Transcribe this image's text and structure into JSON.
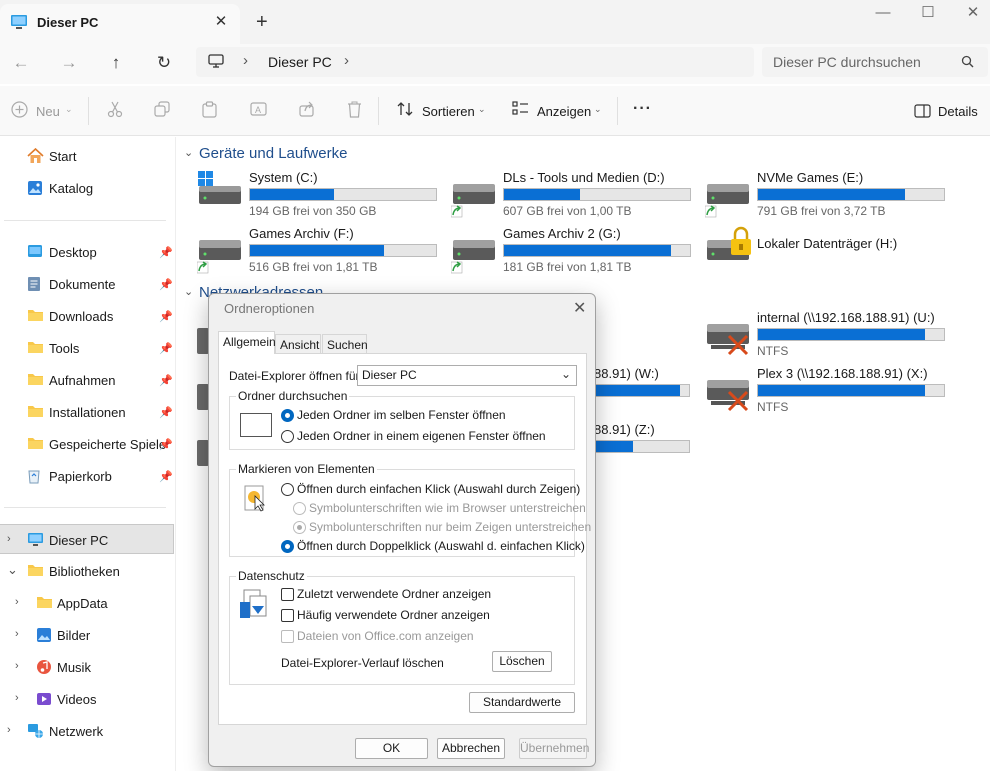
{
  "window": {
    "tab_title": "Dieser PC",
    "close_tab": "✕",
    "new_tab": "+",
    "minimize": "—",
    "maximize": "☐",
    "close": "✕"
  },
  "nav": {
    "location": "Dieser PC",
    "search_placeholder": "Dieser PC durchsuchen"
  },
  "toolbar": {
    "new_label": "Neu",
    "sort_label": "Sortieren",
    "view_label": "Anzeigen",
    "more_label": "···",
    "details_label": "Details"
  },
  "sidebar": {
    "top": [
      {
        "label": "Start",
        "icon": "home-icon"
      },
      {
        "label": "Katalog",
        "icon": "gallery-icon"
      }
    ],
    "quick": [
      {
        "label": "Desktop",
        "icon": "desktop-folder-icon"
      },
      {
        "label": "Dokumente",
        "icon": "documents-icon"
      },
      {
        "label": "Downloads",
        "icon": "folder-icon"
      },
      {
        "label": "Tools",
        "icon": "folder-icon"
      },
      {
        "label": "Aufnahmen",
        "icon": "folder-icon"
      },
      {
        "label": "Installationen",
        "icon": "folder-icon"
      },
      {
        "label": "Gespeicherte Spiele",
        "icon": "folder-icon"
      },
      {
        "label": "Papierkorb",
        "icon": "recycle-bin-icon"
      }
    ],
    "tree": [
      {
        "label": "Dieser PC",
        "icon": "computer-icon"
      },
      {
        "label": "Bibliotheken",
        "icon": "folder-icon"
      },
      {
        "label": "AppData",
        "icon": "folder-icon"
      },
      {
        "label": "Bilder",
        "icon": "pictures-icon"
      },
      {
        "label": "Musik",
        "icon": "music-icon"
      },
      {
        "label": "Videos",
        "icon": "videos-icon"
      },
      {
        "label": "Netzwerk",
        "icon": "network-icon"
      }
    ]
  },
  "main": {
    "section_drives": "Geräte und Laufwerke",
    "section_network": "Netzwerkadressen",
    "drives": [
      {
        "name": "System (C:)",
        "free": "194 GB frei von 350 GB",
        "used_fraction": 0.45
      },
      {
        "name": "DLs - Tools und Medien (D:)",
        "free": "607 GB frei von 1,00 TB",
        "used_fraction": 0.41
      },
      {
        "name": "NVMe Games (E:)",
        "free": "791 GB frei von 3,72 TB",
        "used_fraction": 0.79
      },
      {
        "name": "Games Archiv (F:)",
        "free": "516 GB frei von 1,81 TB",
        "used_fraction": 0.72
      },
      {
        "name": "Games Archiv 2 (G:)",
        "free": "181 GB frei von 1,81 TB",
        "used_fraction": 0.9
      },
      {
        "name": "Lokaler Datenträger (H:)",
        "free": "",
        "used_fraction": null
      }
    ],
    "network": [
      {
        "name": "internal (\\\\192.168.188.91) (U:)",
        "fs": "NTFS",
        "used_fraction": 0.9
      },
      {
        "name": "88.91) (W:)",
        "fs": "",
        "used_fraction": 0.9
      },
      {
        "name": "Plex 3 (\\\\192.168.188.91) (X:)",
        "fs": "NTFS",
        "used_fraction": 0.9
      },
      {
        "name": "88.91) (Z:)",
        "fs": "",
        "used_fraction": 0.4
      }
    ]
  },
  "dialog": {
    "title": "Ordneroptionen",
    "tabs": [
      "Allgemein",
      "Ansicht",
      "Suchen"
    ],
    "open_label": "Datei-Explorer öffnen für:",
    "open_value": "Dieser PC",
    "browse_group": "Ordner durchsuchen",
    "browse_opt1": "Jeden Ordner im selben Fenster öffnen",
    "browse_opt2": "Jeden Ordner in einem eigenen Fenster öffnen",
    "click_group": "Markieren von Elementen",
    "click_opt1": "Öffnen durch einfachen Klick (Auswahl durch Zeigen)",
    "click_opt1a": "Symbolunterschriften wie im Browser unterstreichen",
    "click_opt1b": "Symbolunterschriften nur beim Zeigen unterstreichen",
    "click_opt2": "Öffnen durch Doppelklick (Auswahl d. einfachen Klick)",
    "privacy_group": "Datenschutz",
    "priv_opt1": "Zuletzt verwendete Ordner anzeigen",
    "priv_opt2": "Häufig verwendete Ordner anzeigen",
    "priv_opt3": "Dateien von Office.com anzeigen",
    "clear_label": "Datei-Explorer-Verlauf löschen",
    "clear_btn": "Löschen",
    "defaults_btn": "Standardwerte",
    "ok_btn": "OK",
    "cancel_btn": "Abbrechen",
    "apply_btn": "Übernehmen"
  }
}
